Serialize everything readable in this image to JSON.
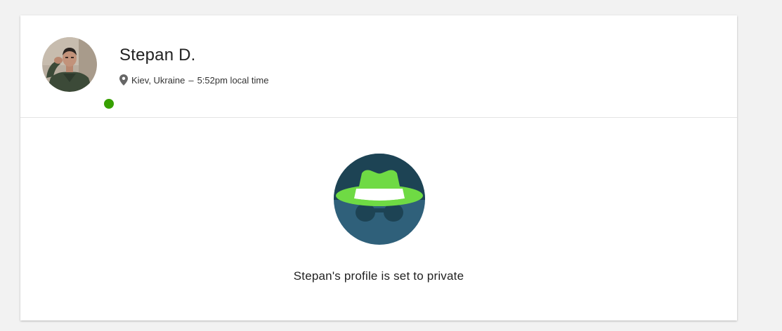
{
  "profile": {
    "name": "Stepan D.",
    "location": "Kiev, Ukraine",
    "separator": "–",
    "local_time": "5:52pm local time",
    "online": true
  },
  "private_notice": {
    "text": "Stepan's profile is set to private"
  },
  "icons": {
    "avatar": "user-photo",
    "status": "online-dot-icon",
    "location": "map-pin-icon",
    "private": "incognito-hat-glasses-icon"
  },
  "colors": {
    "page_bg": "#f2f2f2",
    "card_bg": "#ffffff",
    "online_green": "#37a000",
    "hat_green": "#6fda44",
    "icon_dark_blue": "#1d4354",
    "icon_mid_blue": "#2f607a"
  }
}
